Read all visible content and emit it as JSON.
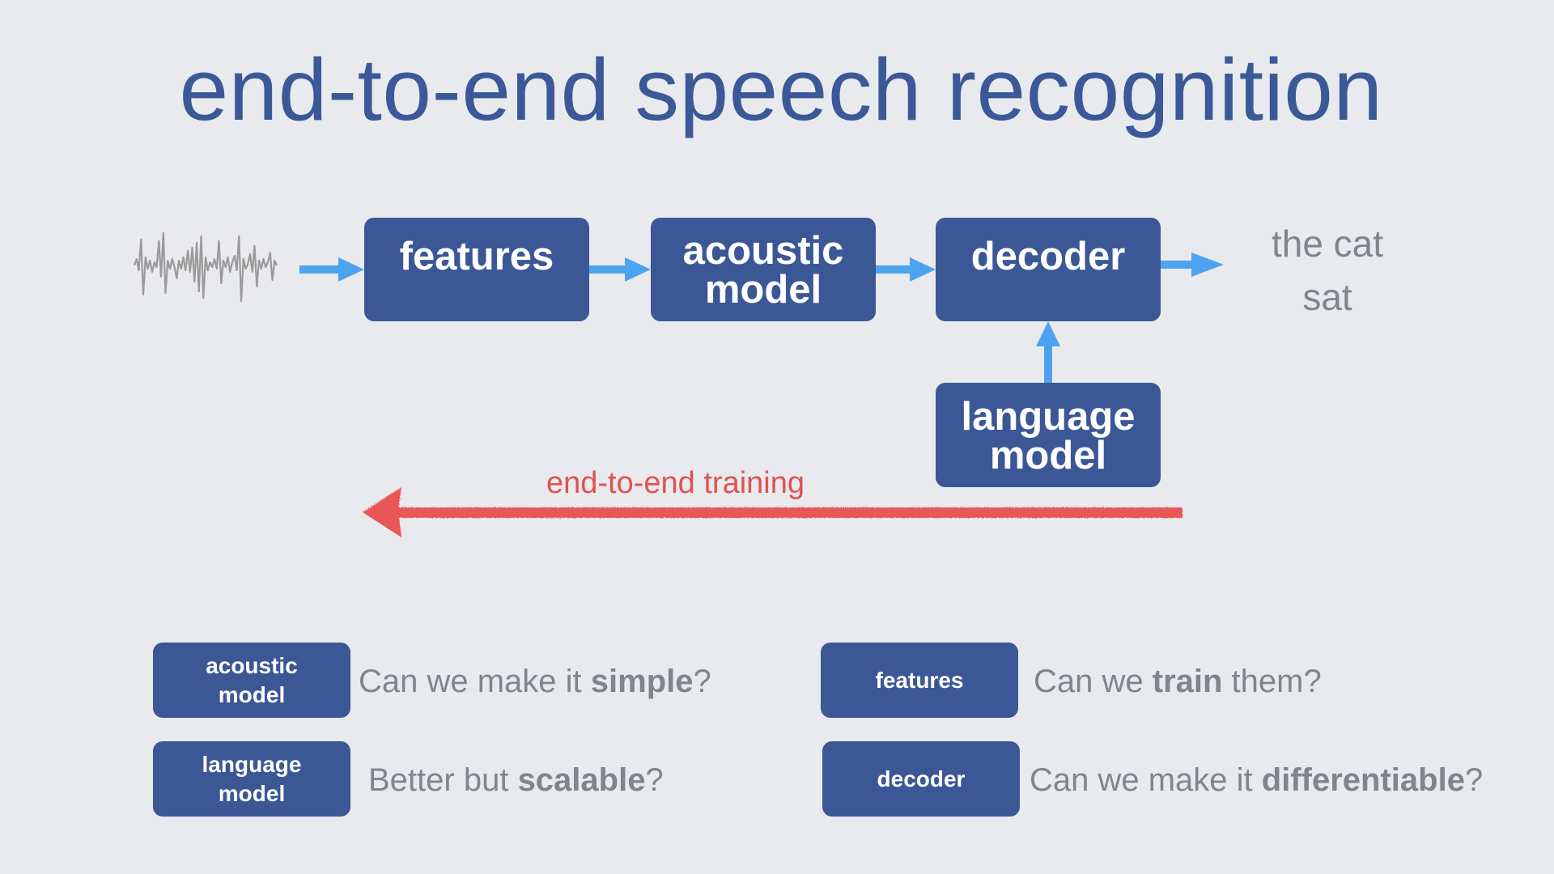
{
  "title": "end-to-end speech recognition",
  "pipeline": {
    "input_icon": "audio-waveform-icon",
    "features": [
      "features"
    ],
    "acoustic_model": [
      "acoustic",
      "model"
    ],
    "decoder": [
      "decoder"
    ],
    "language_model": [
      "language",
      "model"
    ],
    "output": [
      "the cat",
      "sat"
    ]
  },
  "training_arrow": {
    "label": "end-to-end training",
    "direction": "right-to-left"
  },
  "questions": [
    {
      "box": [
        "acoustic",
        "model"
      ],
      "pre": "Can we make it ",
      "bold": "simple",
      "post": "?"
    },
    {
      "box": [
        "language",
        "model"
      ],
      "pre": "Better but ",
      "bold": "scalable",
      "post": "?"
    },
    {
      "box": [
        "features"
      ],
      "pre": "Can we ",
      "bold": "train",
      "post": " them?"
    },
    {
      "box": [
        "decoder"
      ],
      "pre": "Can we make it ",
      "bold": "differentiable",
      "post": "?"
    }
  ],
  "colors": {
    "background": "#e8eaee",
    "title": "#3b5998",
    "box": "#3b5796",
    "flow_arrow": "#4da3f0",
    "training_arrow": "#e05252",
    "muted_text": "#80858d"
  }
}
